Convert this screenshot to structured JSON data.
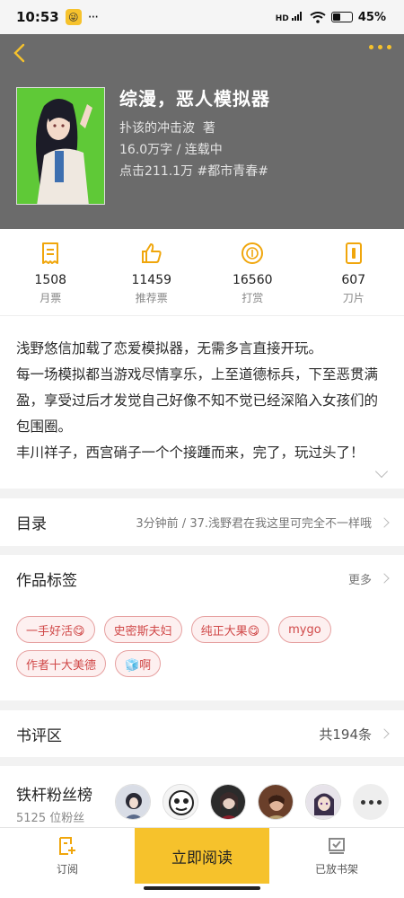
{
  "status_bar": {
    "time": "10:53",
    "app_badge": "😜",
    "dots": "···",
    "signal": "HD",
    "battery": "45",
    "battery_unit": "%"
  },
  "book": {
    "title": "综漫，恶人模拟器",
    "author": "扑该的冲击波",
    "author_suffix": "著",
    "words_status": "16.0万字 / 连载中",
    "clicks_tag": "点击211.1万  #都市青春#"
  },
  "stats": [
    {
      "icon": "monthly-ticket-icon",
      "value": "1508",
      "label": "月票"
    },
    {
      "icon": "thumbs-up-icon",
      "value": "11459",
      "label": "推荐票"
    },
    {
      "icon": "reward-coin-icon",
      "value": "16560",
      "label": "打赏"
    },
    {
      "icon": "blade-card-icon",
      "value": "607",
      "label": "刀片"
    }
  ],
  "synopsis": [
    "浅野悠信加载了恋爱模拟器，无需多言直接开玩。",
    "每一场模拟都当游戏尽情享乐，上至道德标兵，下至恶贯满盈，享受过后才发觉自己好像不知不觉已经深陷入女孩们的包围圈。",
    "丰川祥子，西宫硝子一个个接踵而来，完了，玩过头了！"
  ],
  "catalog": {
    "label": "目录",
    "latest": "3分钟前 / 37.浅野君在我这里可完全不一样哦"
  },
  "tags": {
    "label": "作品标签",
    "more": "更多",
    "items": [
      "一手好活😋",
      "史密斯夫妇",
      "纯正大果😋",
      "mygo",
      "作者十大美德",
      "🧊啊"
    ]
  },
  "reviews": {
    "label": "书评区",
    "count": "共194条"
  },
  "fans": {
    "label": "铁杆粉丝榜",
    "count": "5125 位粉丝"
  },
  "bottom": {
    "subscribe": "订阅",
    "read": "立即阅读",
    "shelf": "已放书架"
  },
  "colors": {
    "accent": "#f6c22c",
    "header_bg": "#6b6b6b",
    "tag_text": "#d04848"
  }
}
